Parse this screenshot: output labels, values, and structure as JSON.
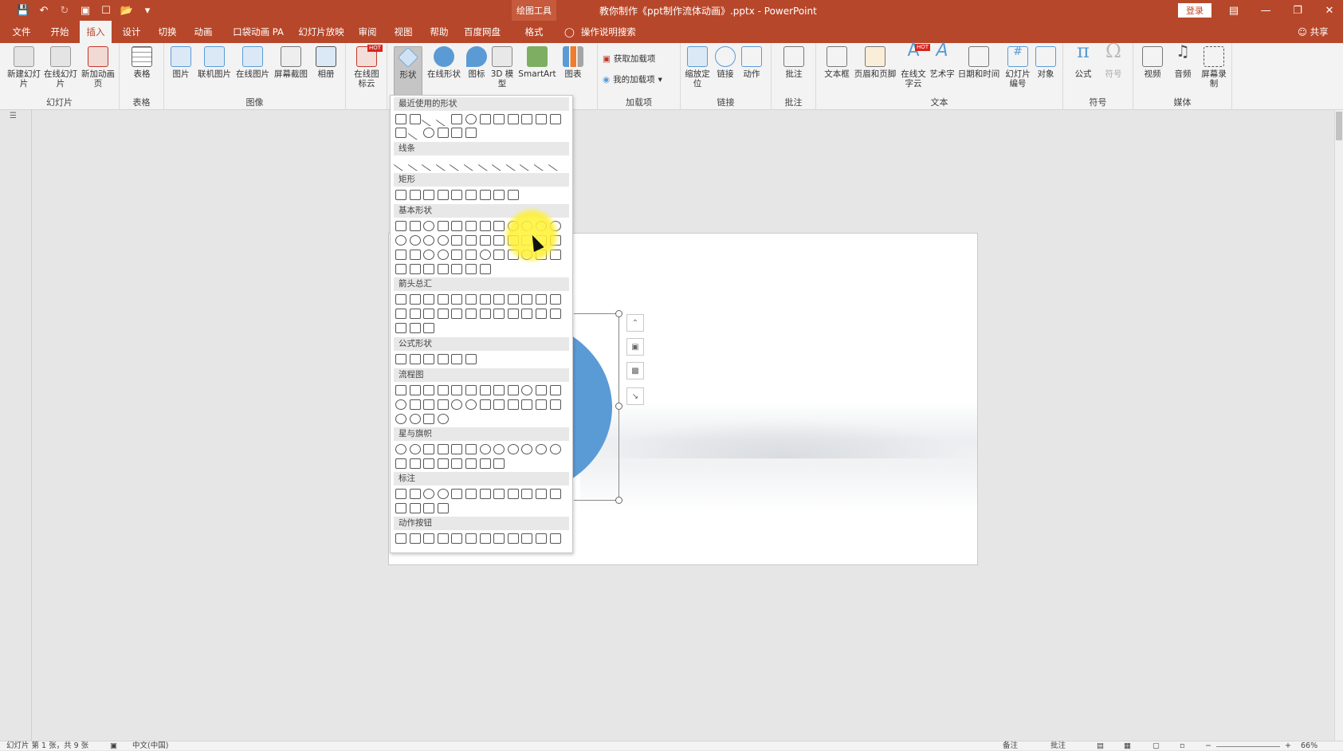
{
  "titlebar": {
    "tool_context": "绘图工具",
    "document_title": "教你制作《ppt制作流体动画》.pptx  -  PowerPoint",
    "login": "登录",
    "qat_icons": [
      "save-icon",
      "undo-icon",
      "redo-icon",
      "start-presentation-icon",
      "new-icon",
      "open-icon",
      "customize-icon"
    ]
  },
  "tabs": {
    "file": "文件",
    "home": "开始",
    "insert": "插入",
    "design": "设计",
    "transitions": "切换",
    "animations": "动画",
    "pocket_animation": "口袋动画 PA",
    "slideshow": "幻灯片放映",
    "review": "审阅",
    "view": "视图",
    "help": "帮助",
    "baidu": "百度网盘",
    "format": "格式",
    "tell_me": "操作说明搜索",
    "share": "共享"
  },
  "ribbon": {
    "slides": {
      "label": "幻灯片",
      "new_slide": "新建幻灯片",
      "online_slide": "在线幻灯片",
      "new_anim": "新加动画页"
    },
    "tables": {
      "label": "表格",
      "table": "表格"
    },
    "images": {
      "label": "图像",
      "picture": "图片",
      "online_picture": "联机图片",
      "online_img": "在线图片",
      "screenshot": "屏幕截图",
      "album": "相册"
    },
    "online_icon_cloud": "在线图标云",
    "illus": {
      "shapes": "形状",
      "online_shapes": "在线形状",
      "icons": "图标",
      "model3d": "3D 模型",
      "smartart": "SmartArt",
      "chart": "图表"
    },
    "addins": {
      "label": "加载项",
      "get": "获取加载项",
      "my": "我的加载项"
    },
    "links": {
      "label": "链接",
      "zoom": "缩放定位",
      "link": "链接",
      "action": "动作"
    },
    "comments": {
      "label": "批注",
      "comment": "批注"
    },
    "text": {
      "label": "文本",
      "textbox": "文本框",
      "header_footer": "页眉和页脚",
      "online_text": "在线文字云",
      "wordart": "艺术字",
      "datetime": "日期和时间",
      "slide_number": "幻灯片编号",
      "object": "对象"
    },
    "symbols": {
      "label": "符号",
      "equation": "公式",
      "symbol": "符号"
    },
    "media": {
      "label": "媒体",
      "video": "视频",
      "audio": "音频",
      "screen_record": "屏幕录制"
    },
    "hot": "HOT"
  },
  "gallery": {
    "sections": [
      "最近使用的形状",
      "线条",
      "矩形",
      "基本形状",
      "箭头总汇",
      "公式形状",
      "流程图",
      "星与旗帜",
      "标注",
      "动作按钮"
    ]
  },
  "status": {
    "slide_info": "幻灯片 第 1 张，共 9 张",
    "language": "中文(中国)",
    "notes": "备注",
    "comments": "批注",
    "zoom": "66%"
  }
}
